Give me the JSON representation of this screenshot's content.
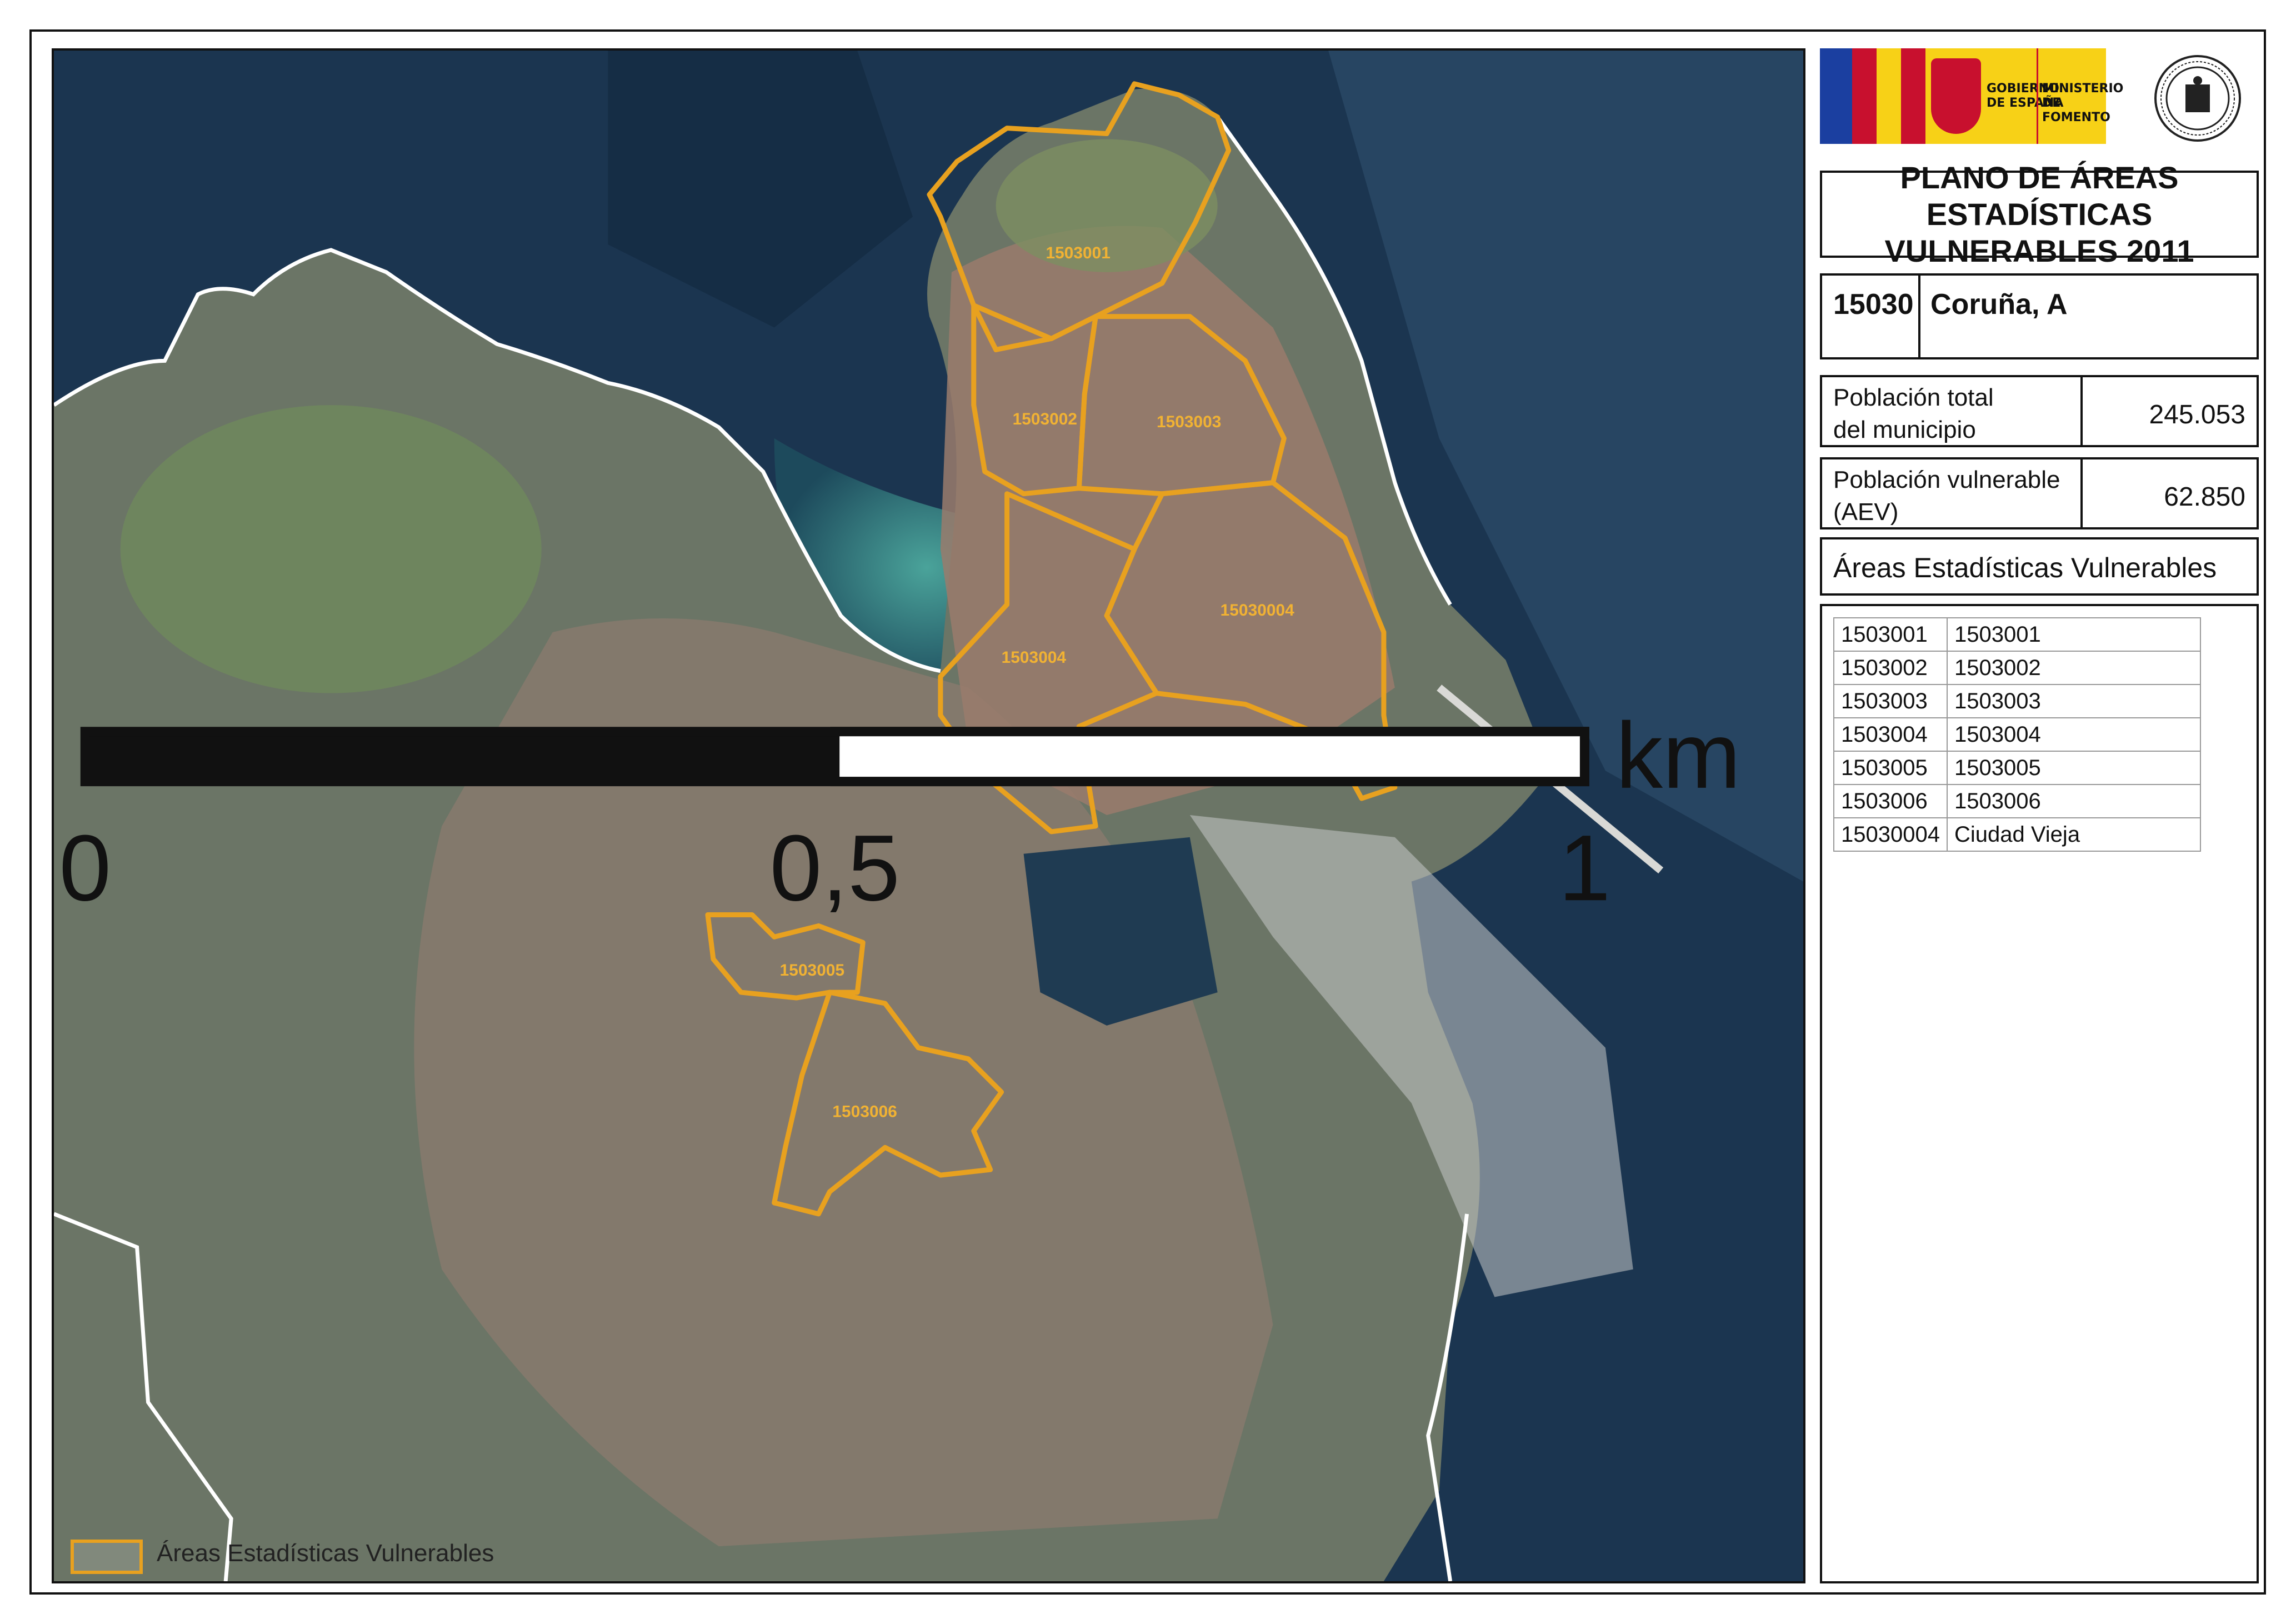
{
  "map": {
    "areas": [
      {
        "code": "1503001"
      },
      {
        "code": "1503002"
      },
      {
        "code": "1503003"
      },
      {
        "code": "15030004"
      },
      {
        "code": "1503004"
      },
      {
        "code": "1503005"
      },
      {
        "code": "1503006"
      }
    ],
    "legend_label": "Áreas Estadísticas Vulnerables",
    "scalebar": {
      "ticks": [
        "0",
        "0,5",
        "1"
      ],
      "unit": "km"
    },
    "colors": {
      "aev_outline": "#e8a11f",
      "municipal_boundary": "#ffffff",
      "sea": "#1b3550",
      "land": "#6b7566"
    }
  },
  "logos": {
    "gov_line1": "GOBIERNO",
    "gov_line2": "DE ESPAÑA",
    "ministry_line1": "MINISTERIO",
    "ministry_line2": "DE FOMENTO",
    "seal_icon": "university-seal-icon"
  },
  "panel": {
    "title_line1": "PLANO DE ÁREAS ESTADÍSTICAS",
    "title_line2": "VULNERABLES 2011",
    "municipality_code": "15030",
    "municipality_name": "Coruña, A",
    "total_population_label_1": "Población total",
    "total_population_label_2": "del municipio",
    "total_population_value": "245.053",
    "vulnerable_population_label_1": "Población vulnerable",
    "vulnerable_population_label_2": "(AEV)",
    "vulnerable_population_value": "62.850",
    "aev_section_title": "Áreas Estadísticas Vulnerables",
    "aev_list": [
      {
        "code": "1503001",
        "name": "1503001"
      },
      {
        "code": "1503002",
        "name": "1503002"
      },
      {
        "code": "1503003",
        "name": "1503003"
      },
      {
        "code": "1503004",
        "name": "1503004"
      },
      {
        "code": "1503005",
        "name": "1503005"
      },
      {
        "code": "1503006",
        "name": "1503006"
      },
      {
        "code": "15030004",
        "name": "Ciudad Vieja"
      }
    ]
  }
}
